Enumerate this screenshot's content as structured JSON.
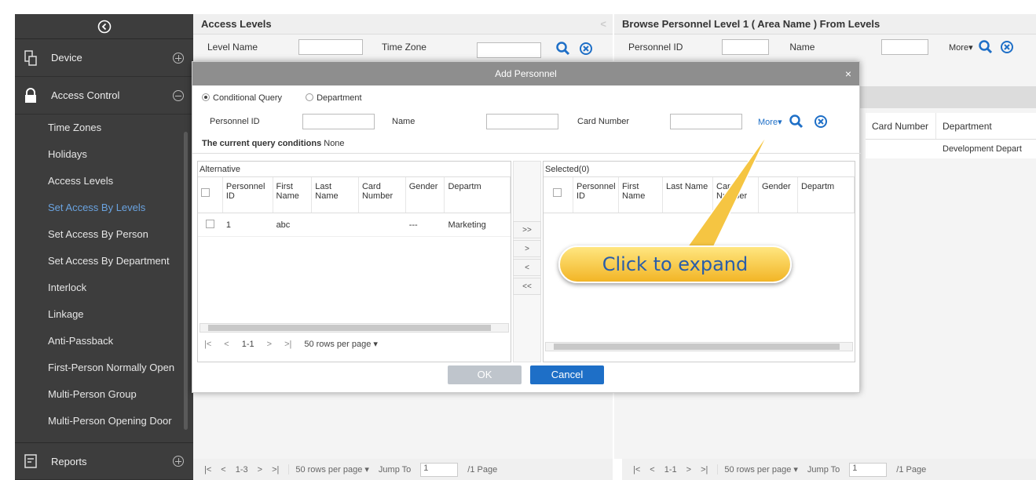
{
  "sidebar": {
    "device": "Device",
    "access_control": "Access Control",
    "items": [
      {
        "label": "Time Zones"
      },
      {
        "label": "Holidays"
      },
      {
        "label": "Access Levels"
      },
      {
        "label": "Set Access By Levels"
      },
      {
        "label": "Set Access By Person"
      },
      {
        "label": "Set Access By Department"
      },
      {
        "label": "Interlock"
      },
      {
        "label": "Linkage"
      },
      {
        "label": "Anti-Passback"
      },
      {
        "label": "First-Person Normally Open"
      },
      {
        "label": "Multi-Person Group"
      },
      {
        "label": "Multi-Person Opening Door"
      }
    ],
    "reports": "Reports"
  },
  "left_panel": {
    "title": "Access Levels",
    "level_name": "Level Name",
    "time_zone": "Time Zone",
    "pager": {
      "first": "|<",
      "prev": "<",
      "range": "1-3",
      "next": ">",
      "last": ">|",
      "rows": "50 rows per page",
      "jump_label": "Jump To",
      "jump_value": "1",
      "pages": "/1 Page"
    }
  },
  "right_panel": {
    "title": "Browse Personnel Level 1 ( Area Name ) From Levels",
    "personnel_id": "Personnel ID",
    "name": "Name",
    "more": "More",
    "card_number": "Card Number",
    "department": "Department",
    "row_department": "Development Depart",
    "pager": {
      "first": "|<",
      "prev": "<",
      "range": "1-1",
      "next": ">",
      "last": ">|",
      "rows": "50 rows per page",
      "jump_label": "Jump To",
      "jump_value": "1",
      "pages": "/1 Page"
    }
  },
  "dialog": {
    "title": "Add Personnel",
    "close": "×",
    "conditional_query": "Conditional Query",
    "department_opt": "Department",
    "personnel_id": "Personnel ID",
    "name": "Name",
    "card_number": "Card Number",
    "more": "More",
    "conditions_label": "The current query conditions",
    "conditions_value": "None",
    "alternative": "Alternative",
    "selected": "Selected(0)",
    "cols": [
      "Personnel ID",
      "First Name",
      "Last Name",
      "Card Number",
      "Gender",
      "Departm"
    ],
    "rows": [
      {
        "id": "1",
        "first": "abc",
        "last": "",
        "card": "",
        "gender": "---",
        "dept": "Marketing"
      }
    ],
    "move": [
      ">>",
      ">",
      "<",
      "<<"
    ],
    "pager": {
      "first": "|<",
      "prev": "<",
      "range": "1-1",
      "next": ">",
      "last": ">|",
      "rows": "50 rows per page"
    },
    "ok": "OK",
    "cancel": "Cancel"
  },
  "callout": "Click to expand",
  "colors": {
    "sidebar": "#3d3d3d",
    "active": "#6aa3e0",
    "accent": "#1e6fc7",
    "callout": "#f2b526"
  }
}
